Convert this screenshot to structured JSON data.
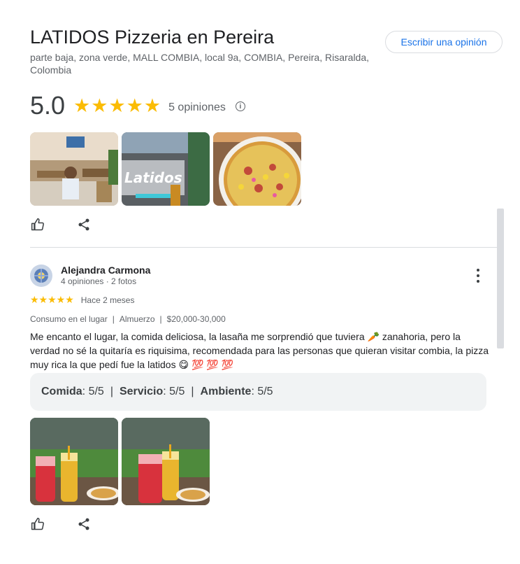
{
  "place": {
    "title": "LATIDOS Pizzeria en Pereira",
    "address": "parte baja, zona verde, MALL COMBIA, local 9a, COMBIA, Pereira, Risaralda, Colombia",
    "write_review_label": "Escribir una opinión",
    "rating": "5.0",
    "stars": "★★★★★",
    "review_count": "5 opiniones",
    "info_icon": "i"
  },
  "review": {
    "author": "Alejandra Carmona",
    "meta": "4 opiniones · 2 fotos",
    "stars": "★★★★★",
    "time": "Hace 2 meses",
    "attrs": [
      "Consumo en el lugar",
      "Almuerzo",
      "$20,000-30,000"
    ],
    "text": "Me encanto el lugar, la comida deliciosa, la lasaña me sorprendió que tuviera 🥕 zanahoria, pero la verdad no sé la quitaría es riquisima, recomendada para las personas que quieran visitar combia, la pizza muy rica la que pedí fue la latidos 😋 💯 💯 💯",
    "subratings": [
      {
        "label": "Comida",
        "value": ": 5/5"
      },
      {
        "label": "Servicio",
        "value": ": 5/5"
      },
      {
        "label": "Ambiente",
        "value": ": 5/5"
      }
    ],
    "sep": "|"
  },
  "photo_labels": {
    "sign_text": "Latidos"
  },
  "colors": {
    "accent": "#1a73e8",
    "star": "#fbbc04",
    "muted": "#5f6368",
    "subrating_bg": "#f1f3f4"
  },
  "icons": [
    "thumbs-up-icon",
    "share-icon",
    "more-vert-icon",
    "info-icon"
  ]
}
